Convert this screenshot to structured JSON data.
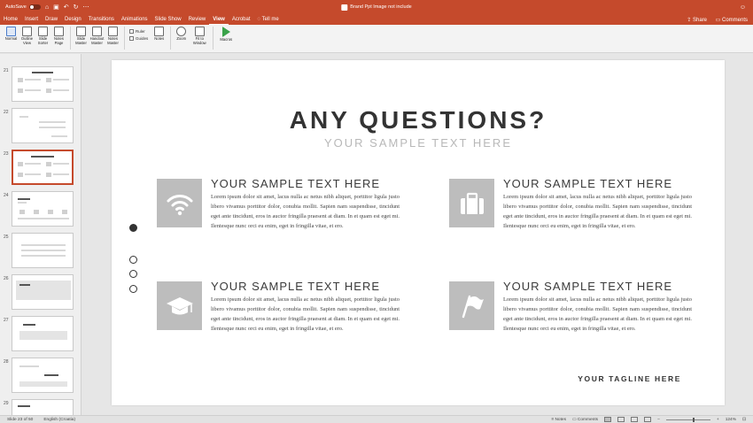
{
  "titlebar": {
    "autosave_label": "AutoSave",
    "autosave_state": "OFF",
    "doc_title": "Brand Ppt Image not include"
  },
  "tabs": [
    "Home",
    "Insert",
    "Draw",
    "Design",
    "Transitions",
    "Animations",
    "Slide Show",
    "Review",
    "View",
    "Acrobat",
    "Tell me"
  ],
  "active_tab": "View",
  "share_label": "Share",
  "comments_label": "Comments",
  "ribbon": {
    "normal": "Normal",
    "outline": "Outline View",
    "slide_sorter": "Slide Sorter",
    "notes_page": "Notes Page",
    "slide_master": "Slide Master",
    "handout_master": "Handout Master",
    "notes_master": "Notes Master",
    "ruler": "Ruler",
    "guides": "Guides",
    "notes": "Notes",
    "zoom": "Zoom",
    "fit_to_window": "Fit to Window",
    "macros": "Macros"
  },
  "thumbnails": [
    {
      "num": "21"
    },
    {
      "num": "22"
    },
    {
      "num": "23"
    },
    {
      "num": "24"
    },
    {
      "num": "25"
    },
    {
      "num": "26"
    },
    {
      "num": "27"
    },
    {
      "num": "28"
    },
    {
      "num": "29"
    }
  ],
  "selected_slide": "23",
  "slide": {
    "title": "ANY QUESTIONS?",
    "subtitle": "YOUR SAMPLE TEXT HERE",
    "features": [
      {
        "heading": "YOUR SAMPLE TEXT HERE",
        "icon": "wifi-icon",
        "body": "Lorem ipsum dolor sit amet, lacus nulla ac netus nibh aliquet, porttitor ligula justo libero vivamus porttitor dolor, conubia mollit. Sapien nam suspendisse, tincidunt eget ante tincidunt, eros in auctor fringilla praesent at diam. In et quam est eget mi. Ilentesque nunc orci eu enim, eget in fringilla vitae, et ero."
      },
      {
        "heading": "YOUR SAMPLE TEXT HERE",
        "icon": "briefcase-icon",
        "body": "Lorem ipsum dolor sit amet, lacus nulla ac netus nibh aliquet, porttitor ligula justo libero vivamus porttitor dolor, conubia mollit. Sapien nam suspendisse, tincidunt eget ante tincidunt, eros in auctor fringilla praesent at diam. In et quam est eget mi. Ilentesque nunc orci eu enim, eget in fringilla vitae, et ero."
      },
      {
        "heading": "YOUR SAMPLE TEXT HERE",
        "icon": "graduation-cap-icon",
        "body": "Lorem ipsum dolor sit amet, lacus nulla ac netus nibh aliquet, porttitor ligula justo libero vivamus porttitor dolor, conubia mollit. Sapien nam suspendisse, tincidunt eget ante tincidunt, eros in auctor fringilla praesent at diam. In et quam est eget mi. Ilentesque nunc orci eu enim, eget in fringilla vitae, et ero."
      },
      {
        "heading": "YOUR SAMPLE TEXT HERE",
        "icon": "flag-icon",
        "body": "Lorem ipsum dolor sit amet, lacus nulla ac netus nibh aliquet, porttitor ligula justo libero vivamus porttitor dolor, conubia mollit. Sapien nam suspendisse, tincidunt eget ante tincidunt, eros in auctor fringilla praesent at diam. In et quam est eget mi. Ilentesque nunc orci eu enim, eget in fringilla vitae, et ero."
      }
    ],
    "tagline": "YOUR TAGLINE HERE"
  },
  "statusbar": {
    "slide_info": "Slide 23 of 50",
    "language": "English (Croatia)",
    "notes": "Notes",
    "comments": "Comments",
    "zoom": "124%"
  },
  "colors": {
    "accent": "#c54a2c",
    "icon_box": "#bdbdbd"
  }
}
